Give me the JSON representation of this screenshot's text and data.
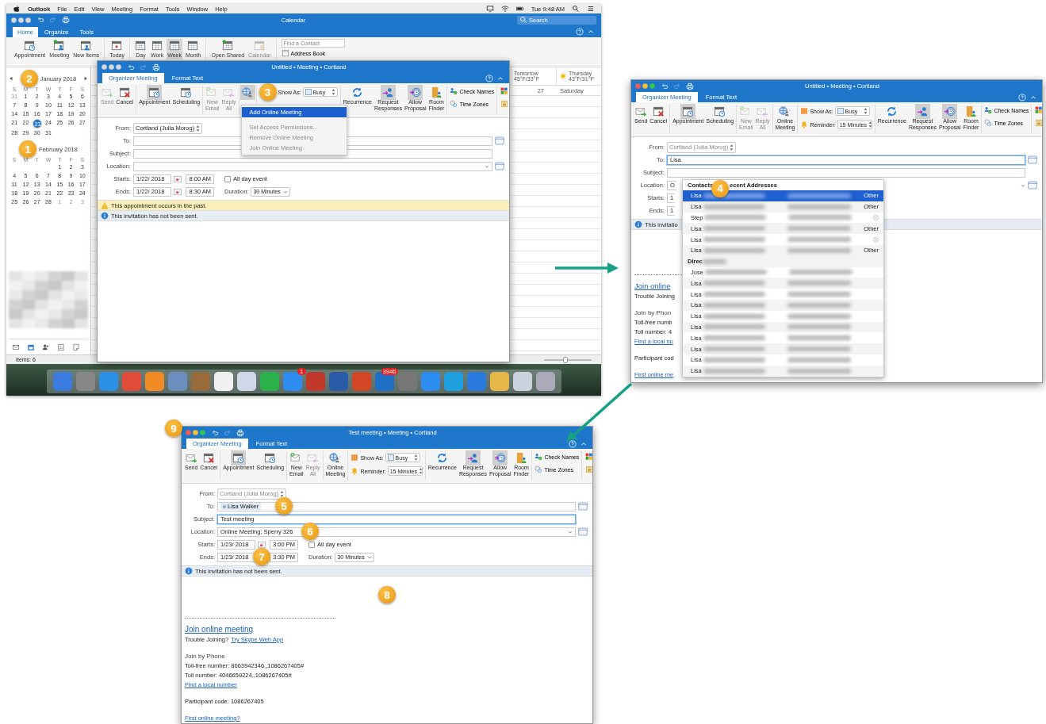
{
  "menu_bar": {
    "app_name": "Outlook",
    "menus": [
      "File",
      "Edit",
      "View",
      "Meeting",
      "Format",
      "Tools",
      "Window",
      "Help"
    ],
    "clock": "Tue 9:48 AM"
  },
  "calendar_window": {
    "title": "Calendar",
    "focused": false,
    "tabs": [
      {
        "label": "Home",
        "selected": true
      },
      {
        "label": "Organize",
        "selected": false
      },
      {
        "label": "Tools",
        "selected": false
      }
    ],
    "search": {
      "placeholder": "Search"
    },
    "ribbon": [
      [
        {
          "kind": "appointment",
          "label": "Appointment"
        },
        {
          "kind": "meeting",
          "label": "Meeting"
        },
        {
          "kind": "new-items",
          "label": "New Items"
        }
      ],
      [
        {
          "kind": "today",
          "label": "Today"
        }
      ],
      [
        {
          "kind": "day",
          "label": "Day",
          "selected": false
        },
        {
          "kind": "work-week",
          "label": "Work",
          "selected": false
        },
        {
          "kind": "week",
          "label": "Week",
          "selected": true
        },
        {
          "kind": "month",
          "label": "Month",
          "selected": false
        }
      ],
      [
        {
          "kind": "open-shared",
          "label": "Open Shared",
          "disabled": false
        },
        {
          "kind": "permissions",
          "label": "Calendar",
          "disabled": true
        }
      ]
    ],
    "contact_search": {
      "placeholder": "Find a Contact"
    },
    "address_book": "Address Book",
    "months": [
      {
        "title": "January 2018",
        "badge": "2",
        "weekdays": [
          "S",
          "M",
          "T",
          "W",
          "T",
          "F",
          "S"
        ],
        "weeks": [
          [
            {
              "day": "31",
              "selected": false,
              "outside": true
            },
            {
              "day": "1",
              "selected": false,
              "outside": false
            },
            {
              "day": "2",
              "selected": false,
              "outside": false
            },
            {
              "day": "3",
              "selected": false,
              "outside": false
            },
            {
              "day": "4",
              "selected": false,
              "outside": false
            },
            {
              "day": "5",
              "selected": false,
              "outside": false
            },
            {
              "day": "6",
              "selected": false,
              "outside": false
            }
          ],
          [
            {
              "day": "7",
              "selected": false,
              "outside": false
            },
            {
              "day": "8",
              "selected": false,
              "outside": false
            },
            {
              "day": "9",
              "selected": false,
              "outside": false
            },
            {
              "day": "10",
              "selected": false,
              "outside": false
            },
            {
              "day": "11",
              "selected": false,
              "outside": false
            },
            {
              "day": "12",
              "selected": false,
              "outside": false
            },
            {
              "day": "13",
              "selected": false,
              "outside": false
            }
          ],
          [
            {
              "day": "14",
              "selected": false,
              "outside": false
            },
            {
              "day": "15",
              "selected": false,
              "outside": false
            },
            {
              "day": "16",
              "selected": false,
              "outside": false
            },
            {
              "day": "17",
              "selected": false,
              "outside": false
            },
            {
              "day": "18",
              "selected": false,
              "outside": false
            },
            {
              "day": "19",
              "selected": false,
              "outside": false
            },
            {
              "day": "20",
              "selected": false,
              "outside": false
            }
          ],
          [
            {
              "day": "21",
              "selected": false,
              "outside": false
            },
            {
              "day": "22",
              "selected": false,
              "outside": false
            },
            {
              "day": "23",
              "selected": true,
              "outside": false
            },
            {
              "day": "24",
              "selected": false,
              "outside": false
            },
            {
              "day": "25",
              "selected": false,
              "outside": false
            },
            {
              "day": "26",
              "selected": false,
              "outside": false
            },
            {
              "day": "27",
              "selected": false,
              "outside": false
            }
          ],
          [
            {
              "day": "28",
              "selected": false,
              "outside": false
            },
            {
              "day": "29",
              "selected": false,
              "outside": false
            },
            {
              "day": "30",
              "selected": false,
              "outside": false
            },
            {
              "day": "31",
              "selected": false,
              "outside": false
            }
          ]
        ]
      },
      {
        "title": "February 2018",
        "badge": "1",
        "weekdays": [
          "S",
          "M",
          "T",
          "W",
          "T",
          "F",
          "S"
        ],
        "weeks": [
          [
            {
              "day": "1",
              "selected": false,
              "outside": false
            },
            {
              "day": "2",
              "selected": false,
              "outside": false
            },
            {
              "day": "3",
              "selected": false,
              "outside": false
            }
          ],
          [
            {
              "day": "4",
              "selected": false,
              "outside": false
            },
            {
              "day": "5",
              "selected": false,
              "outside": false
            },
            {
              "day": "6",
              "selected": false,
              "outside": false
            },
            {
              "day": "7",
              "selected": false,
              "outside": false
            },
            {
              "day": "8",
              "selected": false,
              "outside": false
            },
            {
              "day": "9",
              "selected": false,
              "outside": false
            },
            {
              "day": "10",
              "selected": false,
              "outside": false
            }
          ],
          [
            {
              "day": "11",
              "selected": false,
              "outside": false
            },
            {
              "day": "12",
              "selected": false,
              "outside": false
            },
            {
              "day": "13",
              "selected": false,
              "outside": false
            },
            {
              "day": "14",
              "selected": false,
              "outside": false
            },
            {
              "day": "15",
              "selected": false,
              "outside": false
            },
            {
              "day": "16",
              "selected": false,
              "outside": false
            },
            {
              "day": "17",
              "selected": false,
              "outside": false
            }
          ],
          [
            {
              "day": "18",
              "selected": false,
              "outside": false
            },
            {
              "day": "19",
              "selected": false,
              "outside": false
            },
            {
              "day": "20",
              "selected": false,
              "outside": false
            },
            {
              "day": "21",
              "selected": false,
              "outside": false
            },
            {
              "day": "22",
              "selected": false,
              "outside": false
            },
            {
              "day": "23",
              "selected": false,
              "outside": false
            },
            {
              "day": "24",
              "selected": false,
              "outside": false
            }
          ],
          [
            {
              "day": "25",
              "selected": false,
              "outside": false
            },
            {
              "day": "26",
              "selected": false,
              "outside": false
            },
            {
              "day": "27",
              "selected": false,
              "outside": false
            },
            {
              "day": "28",
              "selected": false,
              "outside": false
            },
            {
              "day": "1",
              "selected": false,
              "outside": true
            },
            {
              "day": "2",
              "selected": false,
              "outside": true
            },
            {
              "day": "3",
              "selected": false,
              "outside": true
            }
          ]
        ]
      }
    ],
    "day_headers": [
      {
        "day": "Tomorrow",
        "weather": "45°F/33°F",
        "sunny": false
      },
      {
        "day": "Thursday",
        "weather": "43°F/31°F",
        "sunny": true
      }
    ],
    "date_row": {
      "number": "27",
      "day": "Saturday"
    },
    "status": "Items: 6",
    "zoom": {
      "level": 0.45
    }
  },
  "dock": {
    "app_store_badge": "1",
    "mail_badge": "3946"
  },
  "meeting_windows": [
    {
      "title": "Untitled • Meeting • Cortland",
      "focused": false,
      "tabs": [
        {
          "label": "Organizer Meeting",
          "selected": true
        },
        {
          "label": "Format Text",
          "selected": false
        }
      ],
      "ribbon": {
        "groups": [
          [
            {
              "kind": "send",
              "label": "Send",
              "disabled": true,
              "pressed": false
            },
            {
              "kind": "cancel",
              "label": "Cancel",
              "disabled": false,
              "pressed": false
            }
          ],
          [
            {
              "kind": "appointment",
              "label": "Appointment",
              "disabled": false,
              "pressed": true
            },
            {
              "kind": "scheduling",
              "label": "Scheduling",
              "disabled": false,
              "pressed": false
            }
          ],
          [
            {
              "kind": "new-email",
              "label": "New Email",
              "disabled": true,
              "pressed": false
            },
            {
              "kind": "reply-all",
              "label": "Reply All",
              "disabled": true,
              "pressed": false
            }
          ],
          [
            {
              "kind": "online-meeting",
              "disabled": false,
              "pressed": true,
              "menu": [
                {
                  "label": "Add Online Meeting",
                  "selected": true,
                  "disabled": false
                },
                {
                  "label": "Set Access Permissions...",
                  "selected": false,
                  "disabled": true
                },
                {
                  "label": "Remove Online Meeting",
                  "selected": false,
                  "disabled": true
                },
                {
                  "label": "Join Online Meeting",
                  "selected": false,
                  "disabled": true
                }
              ]
            }
          ]
        ],
        "badge": "3",
        "show_as": {
          "label": "Show As:",
          "value": "Busy"
        },
        "actions": [
          {
            "kind": "recurrence",
            "label": "Recurrence",
            "disabled": false,
            "pressed": false
          },
          {
            "kind": "request-responses",
            "label": "Request Responses",
            "disabled": false,
            "pressed": true
          },
          {
            "kind": "allow-proposal",
            "label": "Allow Proposal",
            "disabled": false,
            "pressed": true
          },
          {
            "kind": "room-finder",
            "label": "Room Finder",
            "disabled": false,
            "pressed": false
          }
        ],
        "small": [
          {
            "kind": "check-names",
            "label": "Check Names"
          },
          {
            "kind": "time-zones",
            "label": "Time Zones"
          }
        ]
      },
      "fields": [
        {
          "kind": "from",
          "label": "From:",
          "value": "Cortland (Julia Morog)",
          "disabled": false
        },
        {
          "kind": "to",
          "label": "To:",
          "focused": false
        },
        {
          "kind": "subject",
          "label": "Subject:",
          "focused": false
        },
        {
          "kind": "location",
          "label": "Location:",
          "focused": false
        },
        {
          "kind": "time",
          "label": "Starts:",
          "date": "1/22/ 2018",
          "time": "8:00 AM",
          "all_day": {
            "label": "All day event",
            "checked": false
          }
        },
        {
          "kind": "time",
          "label": "Ends:",
          "date": "1/22/ 2018",
          "time": "8:30 AM",
          "duration": {
            "label": "Duration:",
            "value": "30 Minutes"
          }
        }
      ],
      "notices": [
        {
          "kind": "warning",
          "text": "This appointment occurs in the past."
        },
        {
          "kind": "info",
          "text": "This invitation has not been sent."
        }
      ]
    },
    {
      "title": "Untitled • Meeting • Cortland",
      "focused": true,
      "tabs": [
        {
          "label": "Organizer Meeting",
          "selected": true
        },
        {
          "label": "Format Text",
          "selected": false
        }
      ],
      "ribbon": {
        "groups": [
          [
            {
              "kind": "send",
              "label": "Send",
              "disabled": false,
              "pressed": false
            },
            {
              "kind": "cancel",
              "label": "Cancel",
              "disabled": false,
              "pressed": false
            }
          ],
          [
            {
              "kind": "appointment",
              "label": "Appointment",
              "disabled": false,
              "pressed": true
            },
            {
              "kind": "scheduling",
              "label": "Scheduling",
              "disabled": false,
              "pressed": false
            }
          ],
          [
            {
              "kind": "new-email",
              "label": "New Email",
              "disabled": true,
              "pressed": false
            },
            {
              "kind": "reply-all",
              "label": "Reply All",
              "disabled": true,
              "pressed": false
            }
          ],
          [
            {
              "kind": "online-meeting",
              "label": "Online Meeting",
              "disabled": false,
              "pressed": false
            }
          ]
        ],
        "show_as": {
          "label": "Show As:",
          "value": "Busy"
        },
        "reminder": {
          "label": "Reminder:",
          "value": "15 Minutes"
        },
        "actions": [
          {
            "kind": "recurrence",
            "label": "Recurrence",
            "disabled": false,
            "pressed": false
          },
          {
            "kind": "request-responses",
            "label": "Request Responses",
            "disabled": false,
            "pressed": true
          },
          {
            "kind": "allow-proposal",
            "label": "Allow Proposal",
            "disabled": false,
            "pressed": true
          },
          {
            "kind": "room-finder",
            "label": "Room Finder",
            "disabled": false,
            "pressed": false
          }
        ],
        "small": [
          {
            "kind": "check-names",
            "label": "Check Names"
          },
          {
            "kind": "time-zones",
            "label": "Time Zones"
          }
        ]
      },
      "fields": [
        {
          "kind": "from",
          "label": "From:",
          "value": "Cortland (Julia Morog)",
          "disabled": true
        },
        {
          "kind": "to",
          "label": "To:",
          "value": "Lisa",
          "focused": true
        },
        {
          "kind": "subject",
          "label": "Subject:",
          "focused": false
        },
        {
          "kind": "location",
          "label": "Location:",
          "value": "O",
          "focused": false
        },
        {
          "kind": "time",
          "label": "Starts:",
          "date": "1"
        },
        {
          "kind": "time",
          "label": "Ends:",
          "date": "1"
        }
      ],
      "notices": [
        {
          "kind": "info",
          "text": "This invitatio"
        }
      ],
      "autocomplete": {
        "header_start": "Contacts",
        "header_end": "ecent Addresses",
        "badge": "4",
        "rows": [
          {
            "kind": "labeled",
            "name": "Lisa",
            "type": "Other",
            "selected": true
          },
          {
            "kind": "labeled",
            "name": "Lisa",
            "type": "Other",
            "selected": false
          },
          {
            "kind": "removable",
            "name": "Step",
            "selected": false
          },
          {
            "kind": "labeled",
            "name": "Lisa",
            "type": "Other",
            "selected": false
          },
          {
            "kind": "removable",
            "name": "Lisa",
            "selected": false
          },
          {
            "kind": "labeled",
            "name": "Lisa",
            "type": "Other",
            "selected": false
          }
        ],
        "directory_header": "Direc",
        "directory_rows": [
          {
            "name": "Jose",
            "selected": false
          },
          {
            "name": "Lisa",
            "selected": false
          },
          {
            "name": "Lisa",
            "selected": false
          },
          {
            "name": "Lisa",
            "selected": false
          },
          {
            "name": "Lisa",
            "selected": false
          },
          {
            "name": "Lisa",
            "selected": false
          },
          {
            "name": "Lisa",
            "selected": false
          },
          {
            "name": "Lisa",
            "selected": false
          },
          {
            "name": "Lisa",
            "selected": false
          },
          {
            "name": "Lisa",
            "selected": false
          }
        ]
      },
      "body": [
        {
          "kind": "rule"
        },
        {
          "kind": "heading-link",
          "text": "Join online"
        },
        {
          "kind": "text",
          "text": "Trouble Joining"
        },
        {
          "kind": "gap"
        },
        {
          "kind": "subhead",
          "text": "Join by Phon"
        },
        {
          "kind": "text",
          "text": "Toll-free numb"
        },
        {
          "kind": "text",
          "text": "Toll number: 4"
        },
        {
          "kind": "link",
          "text": "Find a local nu"
        },
        {
          "kind": "gap"
        },
        {
          "kind": "text",
          "text": "Participant cod"
        },
        {
          "kind": "gap"
        },
        {
          "kind": "link",
          "text": "First online me"
        }
      ]
    },
    {
      "title": "Test meeting • Meeting • Cortland",
      "focused": true,
      "title_badge": "9",
      "tabs": [
        {
          "label": "Organizer Meeting",
          "selected": true
        },
        {
          "label": "Format Text",
          "selected": false
        }
      ],
      "ribbon": {
        "groups": [
          [
            {
              "kind": "send",
              "label": "Send",
              "disabled": false,
              "pressed": false
            },
            {
              "kind": "cancel",
              "label": "Cancel",
              "disabled": false,
              "pressed": false
            }
          ],
          [
            {
              "kind": "appointment",
              "label": "Appointment",
              "disabled": false,
              "pressed": true
            },
            {
              "kind": "scheduling",
              "label": "Scheduling",
              "disabled": false,
              "pressed": false
            }
          ],
          [
            {
              "kind": "new-email",
              "label": "New Email",
              "disabled": false,
              "pressed": false
            },
            {
              "kind": "reply-all",
              "label": "Reply All",
              "disabled": true,
              "pressed": false
            }
          ],
          [
            {
              "kind": "online-meeting",
              "label": "Online Meeting",
              "disabled": false,
              "pressed": false
            }
          ]
        ],
        "show_as": {
          "label": "Show As:",
          "value": "Busy"
        },
        "reminder": {
          "label": "Reminder:",
          "value": "15 Minutes"
        },
        "actions": [
          {
            "kind": "recurrence",
            "label": "Recurrence",
            "disabled": false,
            "pressed": false
          },
          {
            "kind": "request-responses",
            "label": "Request Responses",
            "disabled": false,
            "pressed": true
          },
          {
            "kind": "allow-proposal",
            "label": "Allow Proposal",
            "disabled": false,
            "pressed": true
          },
          {
            "kind": "room-finder",
            "label": "Room Finder",
            "disabled": false,
            "pressed": false
          }
        ],
        "small": [
          {
            "kind": "check-names",
            "label": "Check Names"
          },
          {
            "kind": "time-zones",
            "label": "Time Zones"
          }
        ]
      },
      "fields": [
        {
          "kind": "from",
          "label": "From:",
          "value": "Cortland (Julia Morog)",
          "disabled": true
        },
        {
          "kind": "to",
          "label": "To:",
          "recipients": [
            "Lisa Walker"
          ],
          "badge": "5",
          "focused": false
        },
        {
          "kind": "subject",
          "label": "Subject:",
          "value": "Test meeting",
          "focused": true
        },
        {
          "kind": "location",
          "label": "Location:",
          "value": "Online Meeting; Sperry 326",
          "badge": "6",
          "focused": false
        },
        {
          "kind": "time",
          "label": "Starts:",
          "date": "1/23/ 2018",
          "time": "3:00 PM",
          "all_day": {
            "label": "All day event",
            "checked": false
          }
        },
        {
          "kind": "time",
          "label": "Ends:",
          "date": "1/23/ 2018",
          "time": "3:30 PM",
          "badge": "7",
          "duration": {
            "label": "Duration:",
            "value": "30 Minutes"
          }
        }
      ],
      "notices": [
        {
          "kind": "info",
          "text": "This invitation has not been sent."
        }
      ],
      "body_badge": "8",
      "body": [
        {
          "kind": "rule"
        },
        {
          "kind": "heading-link",
          "text": "Join online meeting"
        },
        {
          "kind": "mixed",
          "text": "Trouble Joining?",
          "link": "Try Skype Web App"
        },
        {
          "kind": "gap"
        },
        {
          "kind": "subhead",
          "text": "Join by Phone"
        },
        {
          "kind": "text",
          "text": "Toll-free number: 8663942346,,1086267405#"
        },
        {
          "kind": "text",
          "text": "Toll number: 4046659224,,1086267405#"
        },
        {
          "kind": "link",
          "text": "Find a local number"
        },
        {
          "kind": "gap"
        },
        {
          "kind": "text",
          "text": "Participant code: 1086267405"
        },
        {
          "kind": "gap"
        },
        {
          "kind": "link",
          "text": "First online meeting?"
        }
      ]
    }
  ]
}
